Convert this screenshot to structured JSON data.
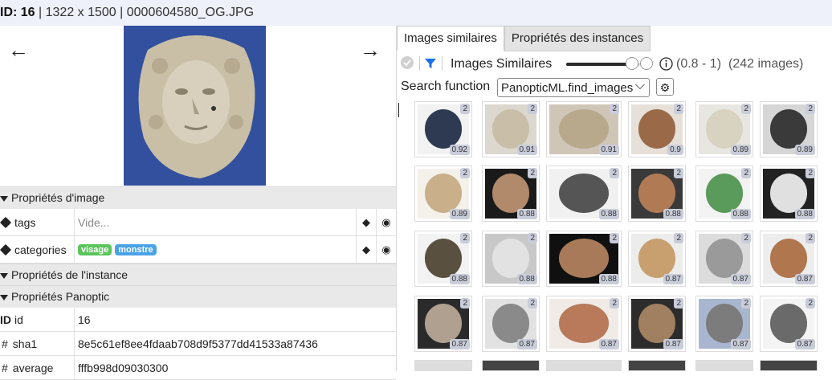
{
  "header": {
    "id_label": "ID:",
    "id_value": "16",
    "separator1": " | ",
    "dimensions": "1322 x 1500",
    "separator2": " | ",
    "filename": "0000604580_OG.JPG"
  },
  "nav": {
    "prev_arrow": "←",
    "next_arrow": "→"
  },
  "sections": {
    "image_props": "Propriétés d'image",
    "instance_props": "Propriétés de l'instance",
    "panoptic_props": "Propriétés Panoptic"
  },
  "properties": {
    "tags": {
      "label": "tags",
      "placeholder": "Vide..."
    },
    "categories": {
      "label": "categories",
      "values": [
        {
          "text": "visage",
          "color": "#5cc45c"
        },
        {
          "text": "monstre",
          "color": "#4aa3e6"
        }
      ]
    },
    "id": {
      "icon": "ID",
      "label": "id",
      "value": "16"
    },
    "sha1": {
      "icon": "#",
      "label": "sha1",
      "value": "8e5c61ef8ee4fdaab708d9f5377dd41533a87436"
    },
    "average": {
      "icon": "#",
      "label": "average",
      "value": "fffb998d09030300"
    }
  },
  "tabs": [
    {
      "label": "Images similaires",
      "active": true
    },
    {
      "label": "Propriétés des instances",
      "active": false
    }
  ],
  "toolbar": {
    "title": "Images Similaires",
    "range": "(0.8 - 1)",
    "count": "(242 images)",
    "slider_level": 0.85
  },
  "search": {
    "label": "Search function",
    "value": "PanopticML.find_images",
    "chevron": "⌵"
  },
  "results": [
    {
      "count": "2",
      "score": "0.92",
      "bg": "#f2f2f2",
      "obj": "#2e3a52"
    },
    {
      "count": "2",
      "score": "0.91",
      "bg": "#dcd8cf",
      "obj": "#c9bfa8"
    },
    {
      "count": "2",
      "score": "0.91",
      "bg": "#cfc6b8",
      "obj": "#b8a98c"
    },
    {
      "count": "2",
      "score": "0.9",
      "bg": "#e6e0d8",
      "obj": "#9a6a48"
    },
    {
      "count": "2",
      "score": "0.89",
      "bg": "#e8e6e0",
      "obj": "#d8d2c0"
    },
    {
      "count": "2",
      "score": "0.89",
      "bg": "#d6d6d6",
      "obj": "#3a3a3a"
    },
    {
      "count": "2",
      "score": "0.89",
      "bg": "#f4f1ea",
      "obj": "#c9b08a"
    },
    {
      "count": "2",
      "score": "0.88",
      "bg": "#1a1a1a",
      "obj": "#b08a6a"
    },
    {
      "count": "2",
      "score": "0.88",
      "bg": "#f1f1f1",
      "obj": "#555555"
    },
    {
      "count": "2",
      "score": "0.88",
      "bg": "#3a3a3a",
      "obj": "#b07a55"
    },
    {
      "count": "2",
      "score": "0.88",
      "bg": "#f3f3f3",
      "obj": "#5a9a5a"
    },
    {
      "count": "2",
      "score": "0.88",
      "bg": "#222222",
      "obj": "#e0e0e0"
    },
    {
      "count": "2",
      "score": "0.88",
      "bg": "#f2f2f2",
      "obj": "#5a5040"
    },
    {
      "count": "2",
      "score": "0.88",
      "bg": "#c8c8c8",
      "obj": "#e2e2e2"
    },
    {
      "count": "2",
      "score": "0.88",
      "bg": "#101010",
      "obj": "#a87a5a"
    },
    {
      "count": "2",
      "score": "0.87",
      "bg": "#ececec",
      "obj": "#c8a070"
    },
    {
      "count": "2",
      "score": "0.87",
      "bg": "#dcdcdc",
      "obj": "#9a9a9a"
    },
    {
      "count": "2",
      "score": "0.87",
      "bg": "#ededed",
      "obj": "#b0764e"
    },
    {
      "count": "2",
      "score": "0.87",
      "bg": "#2a2a2a",
      "obj": "#b0a090"
    },
    {
      "count": "2",
      "score": "0.87",
      "bg": "#e2e2e2",
      "obj": "#8a8a8a"
    },
    {
      "count": "2",
      "score": "0.87",
      "bg": "#f0ebe6",
      "obj": "#b87a5a"
    },
    {
      "count": "2",
      "score": "0.87",
      "bg": "#2c2c2c",
      "obj": "#a08060"
    },
    {
      "count": "2",
      "score": "0.87",
      "bg": "#a9b6cf",
      "obj": "#7c7c7c"
    },
    {
      "count": "2",
      "score": "0.87",
      "bg": "#f4f4f4",
      "obj": "#6a6a6a"
    }
  ]
}
